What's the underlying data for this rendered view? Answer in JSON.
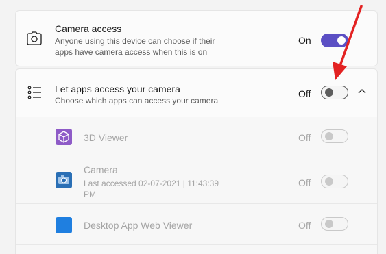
{
  "camera_access": {
    "title": "Camera access",
    "description": "Anyone using this device can choose if their apps have camera access when this is on",
    "state": "On",
    "icon": "camera-icon"
  },
  "apps_access": {
    "title": "Let apps access your camera",
    "description": "Choose which apps can access your camera",
    "state": "Off",
    "icon": "list-icon",
    "expand_icon": "chevron-up-icon"
  },
  "apps": [
    {
      "name": "3D Viewer",
      "detail": "",
      "state": "Off",
      "icon_color": "#8e5bc7"
    },
    {
      "name": "Camera",
      "detail": "Last accessed 02-07-2021  |  11:43:39 PM",
      "state": "Off",
      "icon_color": "#2a6fb5"
    },
    {
      "name": "Desktop App Web Viewer",
      "detail": "",
      "state": "Off",
      "icon_color": "#1f7fe0"
    }
  ],
  "colors": {
    "accent": "#5b4fc4",
    "annotation_arrow": "#e32222"
  }
}
